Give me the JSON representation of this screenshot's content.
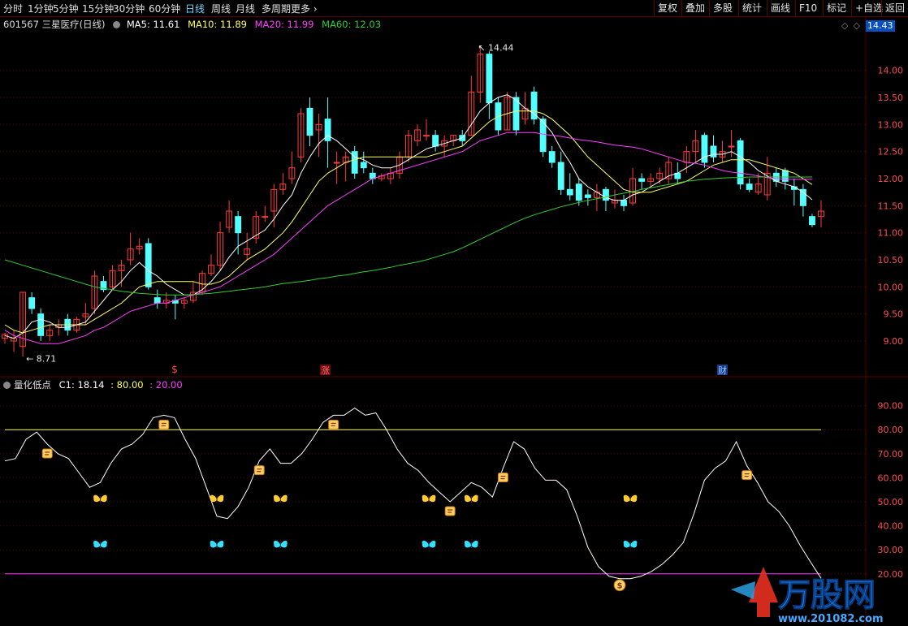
{
  "toolbar": {
    "periods": [
      "分时",
      "1分钟",
      "5分钟",
      "15分钟",
      "30分钟",
      "60分钟",
      "日线",
      "周线",
      "月线",
      "多周期",
      "更多"
    ],
    "active_period": "日线",
    "right": [
      "复权",
      "叠加",
      "多股",
      "统计",
      "画线",
      "F10",
      "标记",
      "+自选",
      "返回"
    ]
  },
  "header": {
    "code": "601567",
    "name": "三星医疗",
    "period_label": "(日线)",
    "ma5": "MA5: 11.61",
    "ma10": "MA10: 11.89",
    "ma20": "MA20: 11.99",
    "ma60": "MA60: 12.03",
    "price_tag": "14.43"
  },
  "indicator": {
    "name": "量化低点",
    "c1": "C1: 18.14",
    "l80": ": 80.00",
    "l20": ": 20.00"
  },
  "colors": {
    "up": "#ff3b3b",
    "down": "#54ffff",
    "ma5": "#ffffff",
    "ma10": "#ffff66",
    "ma20": "#ff40ff",
    "ma60": "#33cc33",
    "grid": "#5a0000",
    "line80": "#ffff66",
    "line20": "#ff40ff"
  },
  "annotations": {
    "high": "14.44",
    "low": "8.71",
    "mark1": "$",
    "mark2": "涨",
    "mark3": "财"
  },
  "watermark": {
    "brand": "万股网",
    "url": "www.201082.com"
  },
  "chart_data": [
    {
      "type": "candlestick",
      "title": "601567 三星医疗 (日线)",
      "ylim": [
        8.7,
        14.7
      ],
      "y_ticks": [
        9.0,
        9.5,
        10.0,
        10.5,
        11.0,
        11.5,
        12.0,
        12.5,
        13.0,
        13.5,
        14.0
      ],
      "candles": [
        [
          9.05,
          9.15,
          9.12,
          8.95
        ],
        [
          9.0,
          9.2,
          9.05,
          8.8
        ],
        [
          8.9,
          9.9,
          9.9,
          8.71
        ],
        [
          9.8,
          9.9,
          9.6,
          9.5
        ],
        [
          9.5,
          9.6,
          9.1,
          9.0
        ],
        [
          9.1,
          9.3,
          9.2,
          9.0
        ],
        [
          9.25,
          9.4,
          9.3,
          9.1
        ],
        [
          9.4,
          9.5,
          9.2,
          9.1
        ],
        [
          9.2,
          9.45,
          9.4,
          9.15
        ],
        [
          9.45,
          9.7,
          9.5,
          9.3
        ],
        [
          9.6,
          10.3,
          10.2,
          9.5
        ],
        [
          10.1,
          10.2,
          9.95,
          9.9
        ],
        [
          10.0,
          10.4,
          10.3,
          9.95
        ],
        [
          10.3,
          10.5,
          10.4,
          10.0
        ],
        [
          10.5,
          11.0,
          10.7,
          10.4
        ],
        [
          10.7,
          10.9,
          10.75,
          10.6
        ],
        [
          10.8,
          10.9,
          10.0,
          9.95
        ],
        [
          9.8,
          9.95,
          9.7,
          9.6
        ],
        [
          9.7,
          9.9,
          9.75,
          9.6
        ],
        [
          9.75,
          9.85,
          9.7,
          9.4
        ],
        [
          9.7,
          9.8,
          9.75,
          9.6
        ],
        [
          9.75,
          10.1,
          9.9,
          9.7
        ],
        [
          9.9,
          10.3,
          10.25,
          9.85
        ],
        [
          10.25,
          10.6,
          10.4,
          10.2
        ],
        [
          10.4,
          11.2,
          11.0,
          10.3
        ],
        [
          11.1,
          11.6,
          11.4,
          11.0
        ],
        [
          11.3,
          11.4,
          11.0,
          10.6
        ],
        [
          10.6,
          11.0,
          10.7,
          10.5
        ],
        [
          10.9,
          11.4,
          11.3,
          10.8
        ],
        [
          11.3,
          11.5,
          11.3,
          11.2
        ],
        [
          11.4,
          11.9,
          11.8,
          11.1
        ],
        [
          11.8,
          12.1,
          11.9,
          11.7
        ],
        [
          12.0,
          12.5,
          12.2,
          11.9
        ],
        [
          12.4,
          13.3,
          13.2,
          12.3
        ],
        [
          13.3,
          13.5,
          12.8,
          12.6
        ],
        [
          12.9,
          13.2,
          13.0,
          12.4
        ],
        [
          13.1,
          13.5,
          12.7,
          12.2
        ],
        [
          12.3,
          12.5,
          12.3,
          11.9
        ],
        [
          12.3,
          12.5,
          12.4,
          11.95
        ],
        [
          12.5,
          12.6,
          12.1,
          12.0
        ],
        [
          12.3,
          12.5,
          12.2,
          12.1
        ],
        [
          12.1,
          12.2,
          12.0,
          11.9
        ],
        [
          12.0,
          12.1,
          12.05,
          11.95
        ],
        [
          12.0,
          12.2,
          12.1,
          11.9
        ],
        [
          12.1,
          12.5,
          12.4,
          12.0
        ],
        [
          12.4,
          12.9,
          12.8,
          12.3
        ],
        [
          12.7,
          13.0,
          12.9,
          12.6
        ],
        [
          12.8,
          13.1,
          12.8,
          12.7
        ],
        [
          12.8,
          12.9,
          12.6,
          12.5
        ],
        [
          12.6,
          12.8,
          12.7,
          12.4
        ],
        [
          12.7,
          12.8,
          12.8,
          12.6
        ],
        [
          12.8,
          12.9,
          12.7,
          12.6
        ],
        [
          12.8,
          13.9,
          13.6,
          12.8
        ],
        [
          13.6,
          14.44,
          14.3,
          13.4
        ],
        [
          14.3,
          14.35,
          13.4,
          13.1
        ],
        [
          13.4,
          13.5,
          12.9,
          12.8
        ],
        [
          12.9,
          13.6,
          13.5,
          12.9
        ],
        [
          13.5,
          13.6,
          12.9,
          12.8
        ],
        [
          13.1,
          13.6,
          13.3,
          13.0
        ],
        [
          13.6,
          13.7,
          13.1,
          13.0
        ],
        [
          13.1,
          13.15,
          12.5,
          12.4
        ],
        [
          12.5,
          12.6,
          12.3,
          12.2
        ],
        [
          12.3,
          12.5,
          11.8,
          11.7
        ],
        [
          11.8,
          12.1,
          11.7,
          11.6
        ],
        [
          11.9,
          12.0,
          11.6,
          11.5
        ],
        [
          11.7,
          11.8,
          11.65,
          11.5
        ],
        [
          11.65,
          11.9,
          11.75,
          11.4
        ],
        [
          11.8,
          11.85,
          11.6,
          11.4
        ],
        [
          11.55,
          11.8,
          11.6,
          11.45
        ],
        [
          11.6,
          11.7,
          11.5,
          11.4
        ],
        [
          11.55,
          12.2,
          12.0,
          11.5
        ],
        [
          12.0,
          12.1,
          11.95,
          11.8
        ],
        [
          11.95,
          12.1,
          12.0,
          11.85
        ],
        [
          12.0,
          12.2,
          12.1,
          11.9
        ],
        [
          12.0,
          12.4,
          12.3,
          11.9
        ],
        [
          12.1,
          12.3,
          12.0,
          11.9
        ],
        [
          12.3,
          12.6,
          12.5,
          12.1
        ],
        [
          12.5,
          12.9,
          12.7,
          12.3
        ],
        [
          12.8,
          12.85,
          12.3,
          12.2
        ],
        [
          12.6,
          12.8,
          12.4,
          12.3
        ],
        [
          12.4,
          12.7,
          12.5,
          12.3
        ],
        [
          12.6,
          12.9,
          12.6,
          12.4
        ],
        [
          12.7,
          12.75,
          11.9,
          11.8
        ],
        [
          11.9,
          12.0,
          11.8,
          11.75
        ],
        [
          11.75,
          12.1,
          11.9,
          11.7
        ],
        [
          11.7,
          12.4,
          12.1,
          11.6
        ],
        [
          12.1,
          12.2,
          11.95,
          11.85
        ],
        [
          12.15,
          12.2,
          11.95,
          11.8
        ],
        [
          11.85,
          12.0,
          11.8,
          11.5
        ],
        [
          11.8,
          11.9,
          11.5,
          11.3
        ],
        [
          11.3,
          11.35,
          11.15,
          11.1
        ],
        [
          11.3,
          11.6,
          11.4,
          11.1
        ]
      ],
      "series": [
        {
          "name": "MA5",
          "values": [
            9.1,
            9.05,
            9.15,
            9.35,
            9.4,
            9.35,
            9.25,
            9.25,
            9.3,
            9.35,
            9.55,
            9.75,
            9.95,
            10.1,
            10.3,
            10.45,
            10.3,
            10.2,
            10.05,
            9.95,
            9.85,
            9.85,
            9.95,
            10.1,
            10.3,
            10.55,
            10.75,
            10.85,
            10.95,
            11.05,
            11.25,
            11.5,
            11.7,
            12.1,
            12.4,
            12.65,
            12.8,
            12.7,
            12.55,
            12.4,
            12.35,
            12.25,
            12.2,
            12.2,
            12.25,
            12.35,
            12.45,
            12.55,
            12.6,
            12.65,
            12.7,
            12.75,
            13.0,
            13.25,
            13.4,
            13.5,
            13.55,
            13.45,
            13.3,
            13.2,
            13.05,
            12.85,
            12.55,
            12.3,
            12.0,
            11.85,
            11.75,
            11.65,
            11.6,
            11.6,
            11.7,
            11.75,
            11.85,
            11.95,
            12.05,
            12.1,
            12.2,
            12.3,
            12.4,
            12.45,
            12.45,
            12.5,
            12.4,
            12.3,
            12.15,
            12.05,
            11.95,
            11.9,
            11.85,
            11.75,
            11.61
          ]
        },
        {
          "name": "MA10",
          "values": [
            9.3,
            9.2,
            9.15,
            9.2,
            9.25,
            9.3,
            9.3,
            9.3,
            9.3,
            9.3,
            9.4,
            9.5,
            9.6,
            9.7,
            9.85,
            10.0,
            10.05,
            10.1,
            10.1,
            10.1,
            10.1,
            10.1,
            10.05,
            10.05,
            10.1,
            10.2,
            10.35,
            10.5,
            10.6,
            10.7,
            10.85,
            11.0,
            11.2,
            11.45,
            11.7,
            11.95,
            12.1,
            12.2,
            12.3,
            12.35,
            12.4,
            12.4,
            12.4,
            12.4,
            12.4,
            12.4,
            12.4,
            12.4,
            12.45,
            12.5,
            12.55,
            12.6,
            12.75,
            12.9,
            13.05,
            13.15,
            13.2,
            13.25,
            13.25,
            13.25,
            13.2,
            13.1,
            12.95,
            12.8,
            12.6,
            12.4,
            12.25,
            12.1,
            11.95,
            11.8,
            11.75,
            11.75,
            11.75,
            11.8,
            11.85,
            11.9,
            11.95,
            12.05,
            12.15,
            12.25,
            12.3,
            12.35,
            12.35,
            12.35,
            12.3,
            12.25,
            12.2,
            12.15,
            12.1,
            12.0,
            11.89
          ]
        },
        {
          "name": "MA20",
          "values": [
            9.2,
            9.1,
            9.05,
            9.0,
            8.95,
            8.95,
            8.95,
            9.0,
            9.05,
            9.1,
            9.2,
            9.25,
            9.35,
            9.45,
            9.55,
            9.6,
            9.65,
            9.7,
            9.7,
            9.75,
            9.8,
            9.85,
            9.9,
            9.95,
            10.0,
            10.1,
            10.2,
            10.3,
            10.4,
            10.5,
            10.6,
            10.75,
            10.9,
            11.05,
            11.2,
            11.35,
            11.5,
            11.6,
            11.7,
            11.8,
            11.9,
            12.0,
            12.05,
            12.1,
            12.15,
            12.2,
            12.25,
            12.3,
            12.35,
            12.4,
            12.45,
            12.5,
            12.6,
            12.7,
            12.75,
            12.8,
            12.85,
            12.85,
            12.85,
            12.85,
            12.82,
            12.8,
            12.78,
            12.75,
            12.72,
            12.7,
            12.68,
            12.65,
            12.62,
            12.6,
            12.58,
            12.55,
            12.5,
            12.45,
            12.4,
            12.35,
            12.3,
            12.28,
            12.25,
            12.2,
            12.15,
            12.12,
            12.1,
            12.08,
            12.05,
            12.02,
            12.0,
            11.99,
            11.99,
            11.99,
            11.99
          ]
        },
        {
          "name": "MA60",
          "values": [
            10.5,
            10.45,
            10.4,
            10.35,
            10.3,
            10.25,
            10.2,
            10.15,
            10.1,
            10.05,
            10.0,
            9.97,
            9.95,
            9.92,
            9.9,
            9.88,
            9.87,
            9.86,
            9.85,
            9.85,
            9.85,
            9.86,
            9.87,
            9.88,
            9.9,
            9.92,
            9.94,
            9.96,
            9.98,
            10.0,
            10.03,
            10.06,
            10.08,
            10.1,
            10.12,
            10.15,
            10.17,
            10.2,
            10.22,
            10.25,
            10.28,
            10.3,
            10.33,
            10.36,
            10.4,
            10.43,
            10.46,
            10.5,
            10.55,
            10.6,
            10.65,
            10.72,
            10.8,
            10.88,
            10.96,
            11.04,
            11.12,
            11.2,
            11.27,
            11.33,
            11.38,
            11.43,
            11.48,
            11.52,
            11.56,
            11.6,
            11.63,
            11.66,
            11.7,
            11.73,
            11.76,
            11.8,
            11.83,
            11.86,
            11.89,
            11.92,
            11.95,
            11.97,
            11.99,
            12.0,
            12.01,
            12.02,
            12.02,
            12.03,
            12.03,
            12.03,
            12.03,
            12.03,
            12.03,
            12.03,
            12.03
          ]
        }
      ]
    },
    {
      "type": "line",
      "title": "量化低点",
      "ylim": [
        0,
        100
      ],
      "y_ticks": [
        20.0,
        30.0,
        40.0,
        50.0,
        60.0,
        70.0,
        80.0,
        90.0
      ],
      "reference_lines": [
        80,
        20
      ],
      "series": [
        {
          "name": "C1",
          "values": [
            67,
            68,
            76,
            79,
            74,
            70,
            68,
            62,
            56,
            58,
            66,
            72,
            74,
            78,
            85,
            86,
            85,
            76,
            68,
            56,
            44,
            43,
            48,
            56,
            67,
            72,
            66,
            66,
            70,
            76,
            83,
            86,
            86,
            89,
            86,
            87,
            80,
            72,
            66,
            63,
            58,
            54,
            50,
            54,
            58,
            56,
            52,
            64,
            75,
            72,
            64,
            59,
            59,
            55,
            44,
            31,
            23,
            19,
            18,
            18,
            19,
            21,
            24,
            28,
            33,
            45,
            59,
            64,
            67,
            75,
            65,
            58,
            50,
            46,
            40,
            32,
            25,
            18.14
          ]
        }
      ],
      "signals": [
        {
          "type": "sell",
          "x": 4
        },
        {
          "type": "sell",
          "x": 15
        },
        {
          "type": "sell",
          "x": 24
        },
        {
          "type": "sell",
          "x": 31
        },
        {
          "type": "sell",
          "x": 42
        },
        {
          "type": "sell",
          "x": 47
        },
        {
          "type": "sell",
          "x": 70
        },
        {
          "type": "buy",
          "x": 58
        }
      ],
      "markers": [
        {
          "color": "yellow",
          "x": 9,
          "y": 51
        },
        {
          "color": "yellow",
          "x": 20,
          "y": 51
        },
        {
          "color": "yellow",
          "x": 26,
          "y": 51
        },
        {
          "color": "yellow",
          "x": 40,
          "y": 51
        },
        {
          "color": "yellow",
          "x": 44,
          "y": 51
        },
        {
          "color": "yellow",
          "x": 59,
          "y": 51
        },
        {
          "color": "cyan",
          "x": 9,
          "y": 32
        },
        {
          "color": "cyan",
          "x": 20,
          "y": 32
        },
        {
          "color": "cyan",
          "x": 26,
          "y": 32
        },
        {
          "color": "cyan",
          "x": 40,
          "y": 32
        },
        {
          "color": "cyan",
          "x": 44,
          "y": 32
        },
        {
          "color": "cyan",
          "x": 59,
          "y": 32
        }
      ]
    }
  ]
}
